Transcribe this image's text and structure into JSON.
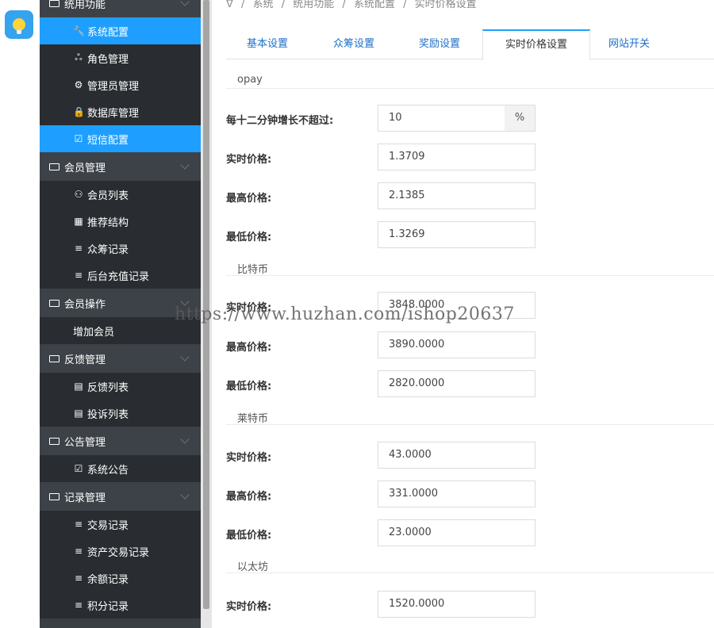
{
  "breadcrumb": [
    "ᐁ",
    "/",
    "系统",
    "/",
    "统用功能",
    "/",
    "系统配置",
    "/",
    "实时价格设置"
  ],
  "sidebar": {
    "groups": [
      {
        "label": "统用功能",
        "items": [
          "系统配置",
          "角色管理",
          "管理员管理",
          "数据库管理",
          "短信配置"
        ]
      },
      {
        "label": "会员管理",
        "items": [
          "会员列表",
          "推荐结构",
          "众筹记录",
          "后台充值记录"
        ]
      },
      {
        "label": "会员操作",
        "items": [
          "增加会员"
        ]
      },
      {
        "label": "反馈管理",
        "items": [
          "反馈列表",
          "投诉列表"
        ]
      },
      {
        "label": "公告管理",
        "items": [
          "系统公告"
        ]
      },
      {
        "label": "记录管理",
        "items": [
          "交易记录",
          "资产交易记录",
          "余额记录",
          "积分记录"
        ]
      }
    ],
    "icons": {
      "系统配置": "🔧",
      "角色管理": "ஃ",
      "管理员管理": "⚙",
      "数据库管理": "🔒",
      "短信配置": "☑",
      "会员列表": "👤",
      "推荐结构": "▦",
      "众筹记录": "≡",
      "后台充值记录": "≡",
      "增加会员": "",
      "反馈列表": "▤",
      "投诉列表": "▤",
      "系统公告": "☑",
      "交易记录": "≡",
      "资产交易记录": "≡",
      "余额记录": "≡",
      "积分记录": "≡"
    }
  },
  "tabs": [
    "基本设置",
    "众筹设置",
    "奖励设置",
    "实时价格设置",
    "网站开关"
  ],
  "sections": {
    "opay": {
      "title": "opay",
      "growth_label": "每十二分钟增长不超过:",
      "growth_value": "10",
      "growth_unit": "%",
      "realtime_label": "实时价格:",
      "realtime_value": "1.3709",
      "high_label": "最高价格:",
      "high_value": "2.1385",
      "low_label": "最低价格:",
      "low_value": "1.3269"
    },
    "btc": {
      "title": "比特币",
      "realtime_label": "实时价格:",
      "realtime_value": "3848.0000",
      "high_label": "最高价格:",
      "high_value": "3890.0000",
      "low_label": "最低价格:",
      "low_value": "2820.0000"
    },
    "ltc": {
      "title": "莱特币",
      "realtime_label": "实时价格:",
      "realtime_value": "43.0000",
      "high_label": "最高价格:",
      "high_value": "331.0000",
      "low_label": "最低价格:",
      "low_value": "23.0000"
    },
    "eth": {
      "title": "以太坊",
      "realtime_label": "实时价格:",
      "realtime_value": "1520.0000"
    }
  },
  "watermark": "https://www.huzhan.com/ishop20637",
  "colors": {
    "sidebar_bg": "#3a3f44",
    "sidebar_item_bg": "#292d31",
    "active": "#1e9fff",
    "tab_link": "#1e6fc9"
  }
}
